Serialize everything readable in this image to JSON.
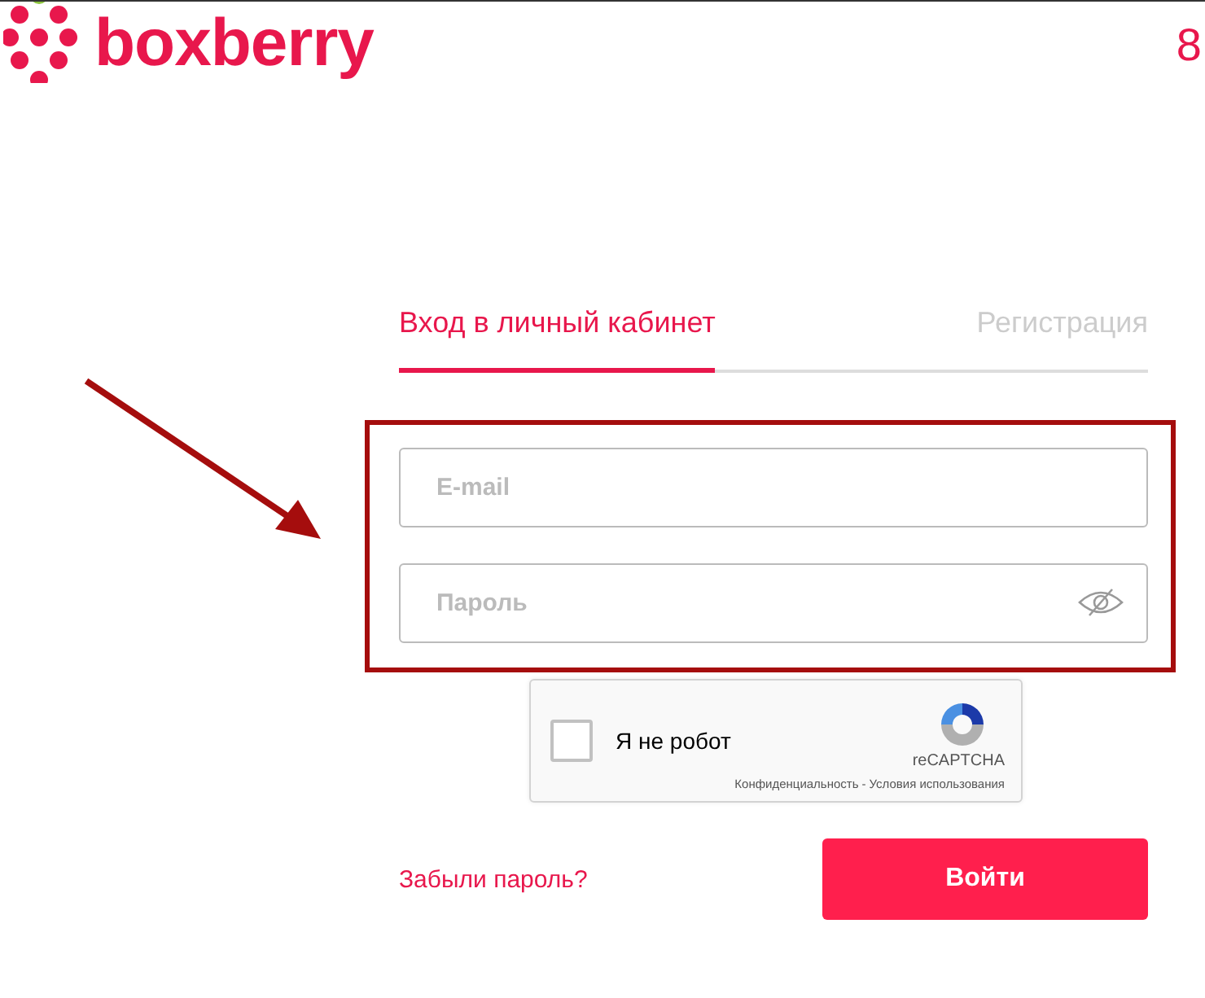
{
  "header": {
    "logo_text": "boxberry",
    "phone": "8"
  },
  "tabs": [
    {
      "label": "Вход в личный кабинет",
      "selected": true
    },
    {
      "label": "Регистрация",
      "selected": false
    }
  ],
  "fields": [
    {
      "placeholder": "E-mail",
      "kind": "text"
    },
    {
      "placeholder": "Пароль",
      "kind": "password"
    }
  ],
  "captcha": {
    "label": "Я не робот",
    "checked": false,
    "brand": "reCAPTCHA",
    "privacy": "Конфиденциальность",
    "separator": "-",
    "terms": "Условия использования"
  },
  "forgot_link": "Забыли пароль?",
  "submit_button": "Войти"
}
